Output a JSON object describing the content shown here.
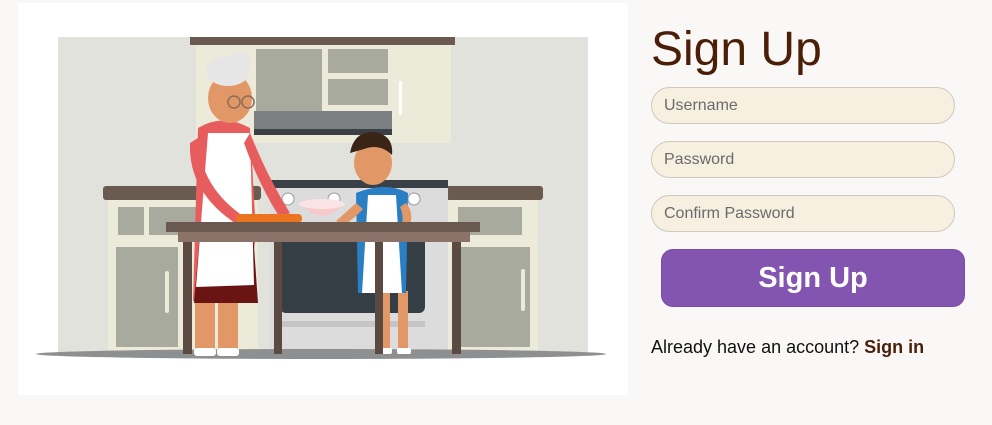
{
  "form": {
    "title": "Sign Up",
    "username_placeholder": "Username",
    "password_placeholder": "Password",
    "confirm_password_placeholder": "Confirm Password",
    "submit_label": "Sign Up",
    "account_prompt": "Already have an account?",
    "signin_label": "Sign in"
  },
  "colors": {
    "title": "#4a1e07",
    "button": "#8455b0",
    "field_bg": "#f7efe0",
    "link": "#4a1e07"
  },
  "illustration": {
    "subject": "grandmother-and-child-baking-in-kitchen"
  }
}
